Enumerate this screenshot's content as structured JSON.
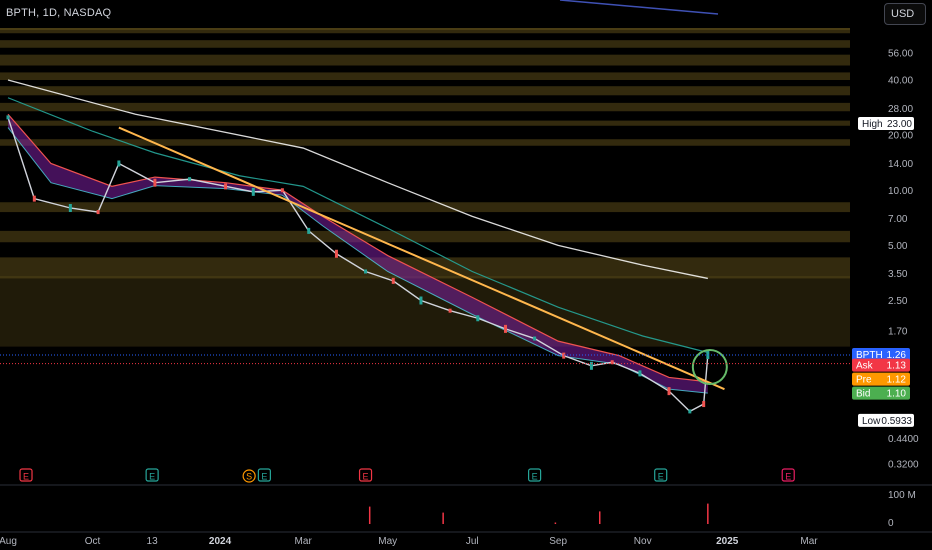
{
  "header": {
    "symbol_line": "BPTH, 1D, NASDAQ",
    "currency_button": "USD"
  },
  "colors": {
    "background": "#000000",
    "price_candle": "#d1d4dc",
    "ema_fast": "#ef5350",
    "ema_mid": "#26a69a",
    "ema_slow": "#ffffff",
    "trendline": "#ffb74d",
    "ribbon": "#7b1fa2",
    "band": "#5d4d1a",
    "bpth_tag": "#2962ff",
    "ask_tag": "#f23645",
    "pre_tag": "#ff9800",
    "bid_tag": "#4caf50",
    "circle": "#66bb6a",
    "volume": "#f23645"
  },
  "chart_data": {
    "type": "line",
    "title": "BPTH, 1D, NASDAQ",
    "y_scale": "log",
    "y_ticks": [
      "56.00",
      "40.00",
      "28.00",
      "20.00",
      "14.00",
      "10.00",
      "7.00",
      "5.00",
      "3.50",
      "2.50",
      "1.70",
      "0.4400",
      "0.3200"
    ],
    "y_tick_values": [
      56,
      40,
      28,
      20,
      14,
      10,
      7,
      5,
      3.5,
      2.5,
      1.7,
      0.44,
      0.32
    ],
    "x_ticks": [
      {
        "label": "Aug",
        "bold": false
      },
      {
        "label": "Oct",
        "bold": false
      },
      {
        "label": "13",
        "bold": false
      },
      {
        "label": "2024",
        "bold": true
      },
      {
        "label": "Mar",
        "bold": false
      },
      {
        "label": "May",
        "bold": false
      },
      {
        "label": "Jul",
        "bold": false
      },
      {
        "label": "Sep",
        "bold": false
      },
      {
        "label": "Nov",
        "bold": false
      },
      {
        "label": "2025",
        "bold": true
      },
      {
        "label": "Mar",
        "bold": false
      }
    ],
    "x_tick_dates": [
      "2023-08-01",
      "2023-10-01",
      "2023-11-13",
      "2024-01-01",
      "2024-03-01",
      "2024-05-01",
      "2024-07-01",
      "2024-09-01",
      "2024-11-01",
      "2025-01-01",
      "2025-03-01"
    ],
    "price_series": {
      "name": "BPTH",
      "dates": [
        "2023-08-01",
        "2023-08-20",
        "2023-09-15",
        "2023-10-05",
        "2023-10-20",
        "2023-11-15",
        "2023-12-10",
        "2024-01-05",
        "2024-01-25",
        "2024-02-15",
        "2024-03-05",
        "2024-03-25",
        "2024-04-15",
        "2024-05-05",
        "2024-05-25",
        "2024-06-15",
        "2024-07-05",
        "2024-07-25",
        "2024-08-15",
        "2024-09-05",
        "2024-09-25",
        "2024-10-10",
        "2024-10-30",
        "2024-11-20",
        "2024-12-05",
        "2024-12-15",
        "2024-12-18"
      ],
      "values": [
        25,
        9.0,
        8.0,
        7.6,
        14,
        11,
        11.5,
        10.5,
        9.8,
        10,
        6.0,
        4.5,
        3.6,
        3.2,
        2.5,
        2.2,
        2.0,
        1.75,
        1.55,
        1.25,
        1.1,
        1.15,
        1.0,
        0.8,
        0.62,
        0.68,
        1.26
      ]
    },
    "ema_slow": {
      "dates": [
        "2023-08-01",
        "2023-11-01",
        "2024-01-01",
        "2024-03-01",
        "2024-05-01",
        "2024-07-01",
        "2024-09-01",
        "2024-11-01",
        "2024-12-18"
      ],
      "values": [
        40,
        26,
        21,
        17,
        11,
        7.2,
        5.0,
        3.9,
        3.3
      ]
    },
    "ema_mid": {
      "dates": [
        "2023-08-01",
        "2023-10-01",
        "2023-11-15",
        "2024-01-15",
        "2024-03-01",
        "2024-05-01",
        "2024-07-01",
        "2024-09-01",
        "2024-11-01",
        "2024-12-18"
      ],
      "values": [
        32,
        21,
        16,
        12,
        10.5,
        6.2,
        3.6,
        2.3,
        1.6,
        1.3
      ]
    },
    "ema_fast": {
      "dates": [
        "2023-08-01",
        "2023-09-01",
        "2023-10-15",
        "2023-11-15",
        "2024-01-05",
        "2024-02-15",
        "2024-03-15",
        "2024-05-01",
        "2024-07-01",
        "2024-09-01",
        "2024-10-15",
        "2024-11-20",
        "2024-12-18"
      ],
      "values": [
        26,
        14,
        10.5,
        11.8,
        11,
        10,
        7.2,
        4.4,
        2.6,
        1.5,
        1.25,
        0.95,
        0.9
      ]
    },
    "ema_low": {
      "dates": [
        "2023-08-01",
        "2023-09-01",
        "2023-10-15",
        "2023-11-15",
        "2024-01-05",
        "2024-02-15",
        "2024-03-15",
        "2024-05-01",
        "2024-07-01",
        "2024-09-01",
        "2024-10-15",
        "2024-11-20",
        "2024-12-18"
      ],
      "values": [
        22,
        11,
        9.0,
        10.6,
        10.2,
        9.4,
        6.4,
        3.6,
        2.1,
        1.25,
        1.12,
        0.82,
        0.78
      ]
    },
    "trendline": {
      "start": {
        "date": "2023-10-20",
        "value": 22
      },
      "end": {
        "date": "2024-12-30",
        "value": 0.82
      }
    },
    "bands": [
      {
        "low": 95,
        "high": 110
      },
      {
        "low": 72,
        "high": 80
      },
      {
        "low": 60,
        "high": 66
      },
      {
        "low": 48,
        "high": 55
      },
      {
        "low": 40,
        "high": 44
      },
      {
        "low": 33,
        "high": 37
      },
      {
        "low": 27,
        "high": 30
      },
      {
        "low": 22.5,
        "high": 24
      },
      {
        "low": 17.5,
        "high": 19
      },
      {
        "low": 7.6,
        "high": 8.6
      },
      {
        "low": 5.2,
        "high": 6.0
      },
      {
        "low": 3.3,
        "high": 4.3
      },
      {
        "low": 1.4,
        "high": 3.4
      }
    ],
    "price_tags": [
      {
        "label": "BPTH",
        "value": "1.26",
        "color": "#2962ff"
      },
      {
        "label": "Ask",
        "value": "1.13",
        "color": "#f23645"
      },
      {
        "label": "Pre",
        "value": "1.12",
        "color": "#ff9800"
      },
      {
        "label": "Bid",
        "value": "1.10",
        "color": "#4caf50"
      }
    ],
    "high_label": {
      "label": "High",
      "value": "23.00"
    },
    "low_label": {
      "label": "Low",
      "value": "0.5933"
    },
    "events": [
      {
        "letter": "E",
        "date": "2023-08-14",
        "color": "#f23645"
      },
      {
        "letter": "E",
        "date": "2023-11-13",
        "color": "#26a69a"
      },
      {
        "letter": "S",
        "date": "2024-01-22",
        "color": "#ff9800"
      },
      {
        "letter": "E",
        "date": "2024-02-02",
        "color": "#26a69a"
      },
      {
        "letter": "E",
        "date": "2024-04-15",
        "color": "#f23645"
      },
      {
        "letter": "E",
        "date": "2024-08-15",
        "color": "#26a69a"
      },
      {
        "letter": "E",
        "date": "2024-11-14",
        "color": "#26a69a"
      },
      {
        "letter": "E",
        "date": "2025-02-14",
        "color": "#e91e63"
      }
    ],
    "volume": {
      "axis_labels": [
        "100 M",
        "0"
      ],
      "spikes": [
        {
          "date": "2024-04-18",
          "value": 58
        },
        {
          "date": "2024-06-10",
          "value": 38
        },
        {
          "date": "2024-08-30",
          "value": 5
        },
        {
          "date": "2024-10-01",
          "value": 42
        },
        {
          "date": "2024-12-18",
          "value": 68
        }
      ]
    },
    "xlabel": "",
    "ylabel": ""
  }
}
